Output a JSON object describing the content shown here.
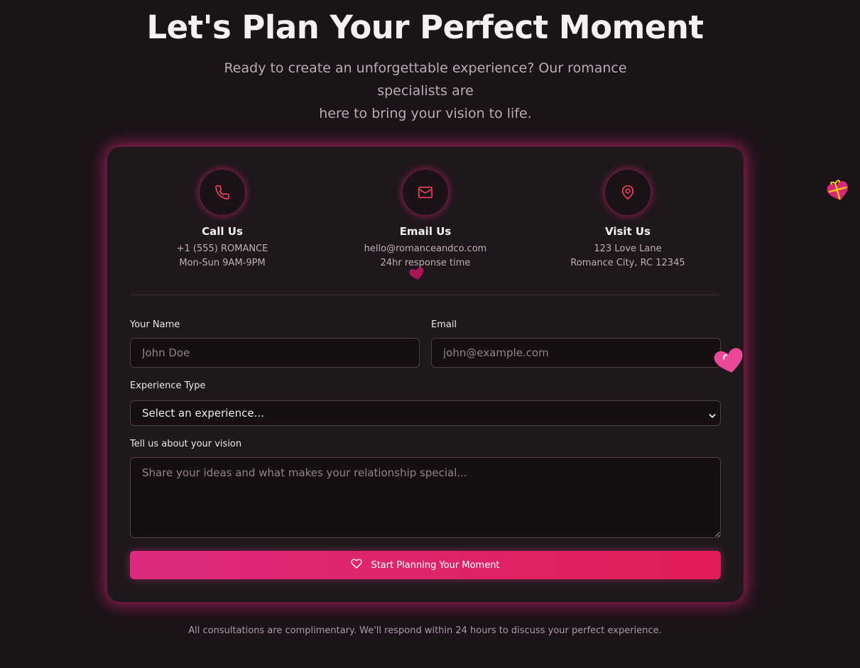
{
  "hero": {
    "title": "Let's Plan Your Perfect Moment",
    "subtitle_line1": "Ready to create an unforgettable experience? Our romance specialists are",
    "subtitle_line2": "here to bring your vision to life."
  },
  "contacts": [
    {
      "icon": "phone-icon",
      "title": "Call Us",
      "line1": "+1 (555) ROMANCE",
      "line2": "Mon-Sun 9AM-9PM"
    },
    {
      "icon": "mail-icon",
      "title": "Email Us",
      "line1": "hello@romanceandco.com",
      "line2": "24hr response time"
    },
    {
      "icon": "map-pin-icon",
      "title": "Visit Us",
      "line1": "123 Love Lane",
      "line2": "Romance City, RC 12345"
    }
  ],
  "form": {
    "name_label": "Your Name",
    "name_placeholder": "John Doe",
    "name_value": "",
    "email_label": "Email",
    "email_placeholder": "john@example.com",
    "email_value": "",
    "experience_label": "Experience Type",
    "experience_selected": "Select an experience...",
    "vision_label": "Tell us about your vision",
    "vision_placeholder": "Share your ideas and what makes your relationship special...",
    "submit_label": "Start Planning Your Moment",
    "submit_icon": "heart-outline-icon"
  },
  "footer": {
    "note": "All consultations are complimentary. We'll respond within 24 hours to discuss your perfect experience."
  },
  "decorations": [
    "heart-emoji-icon",
    "heart-emoji-icon",
    "gift-heart-emoji-icon"
  ],
  "colors": {
    "background": "#1a1418",
    "card": "#1e171b",
    "accent": "#ec4899",
    "icon_accent": "#f43f5e",
    "button_gradient_start": "#dc2b7e",
    "button_gradient_end": "#e11d56"
  }
}
